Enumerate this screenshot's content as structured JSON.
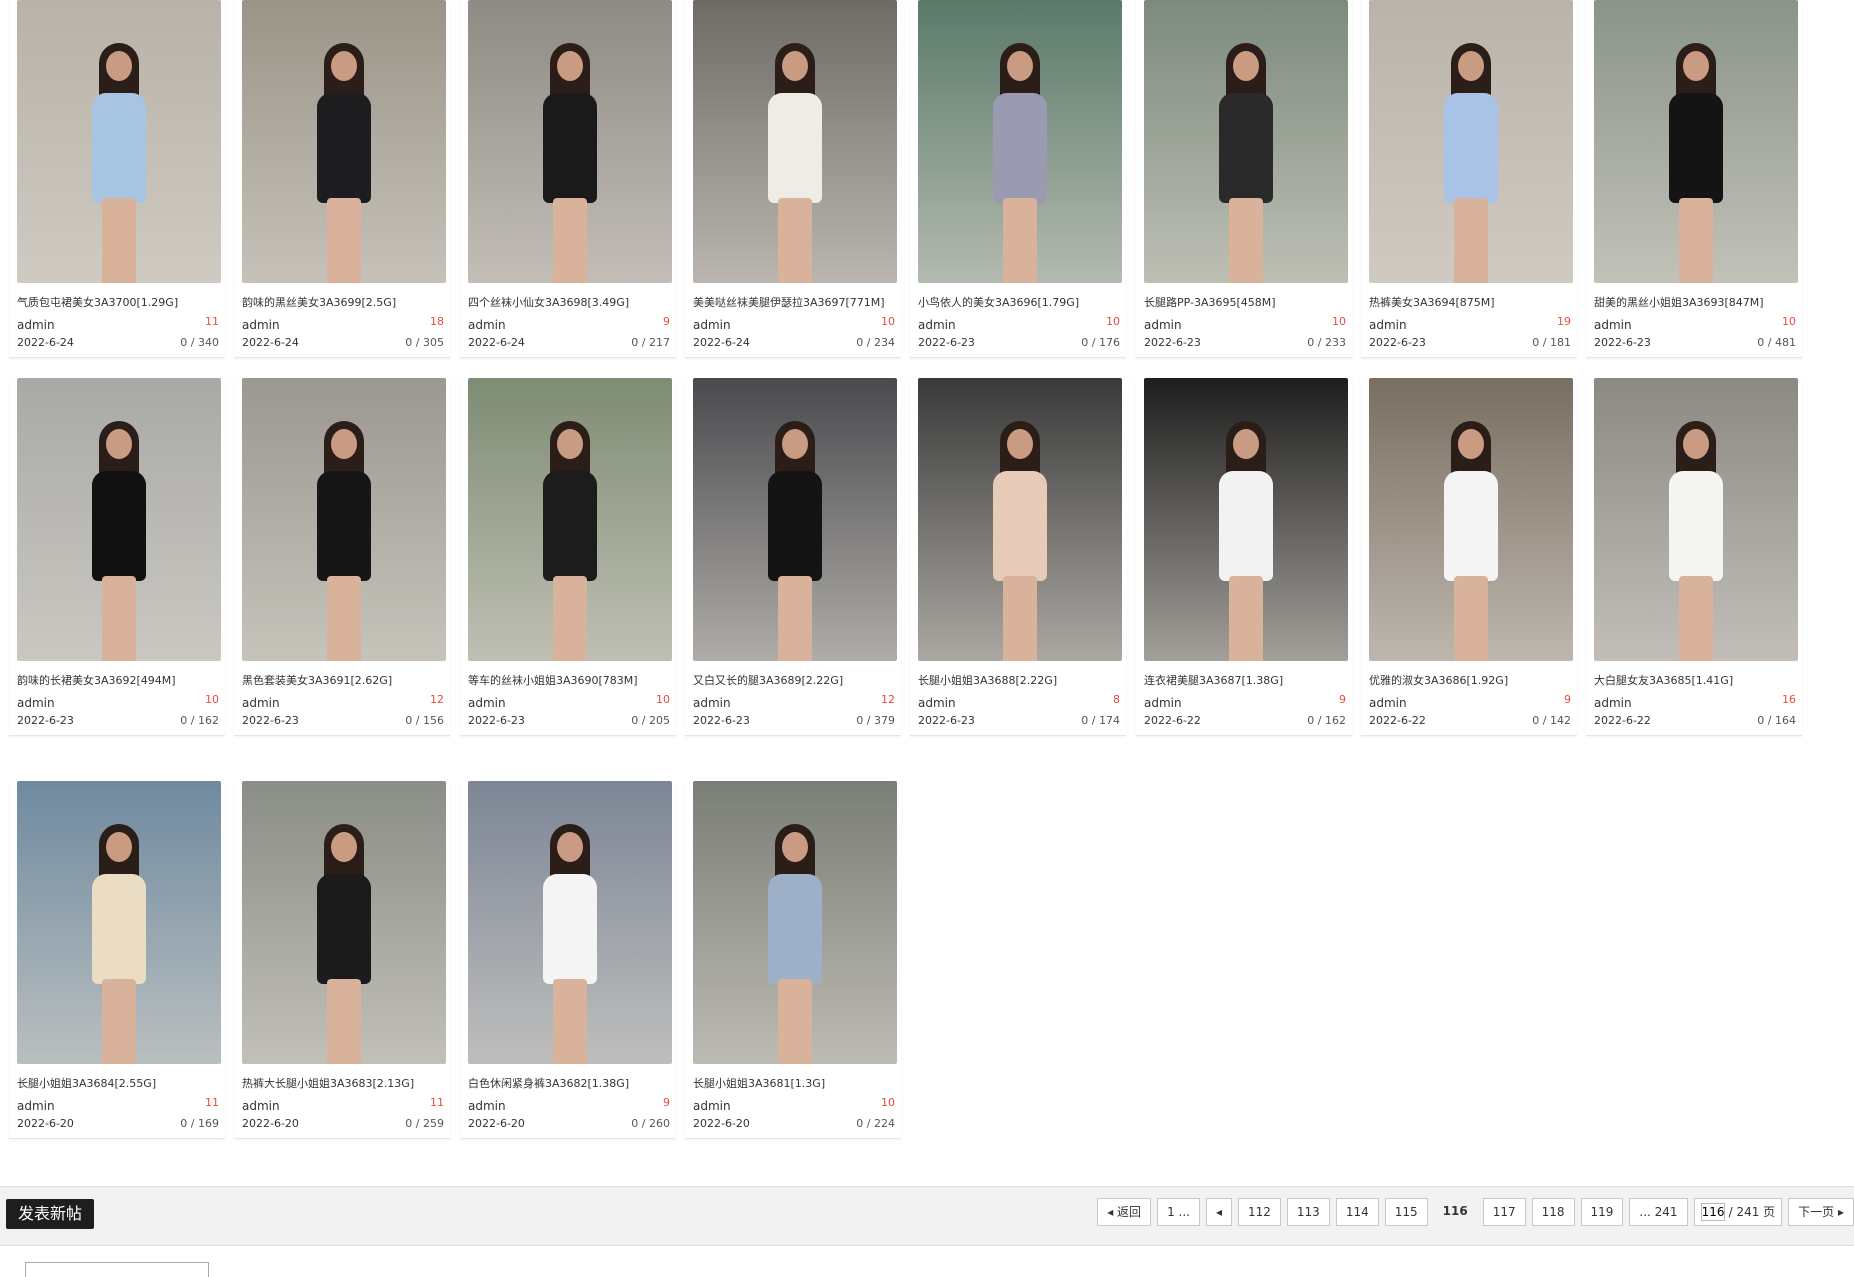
{
  "cards": [
    {
      "title": "气质包屯裙美女3A3700[1.29G]",
      "author": "admin",
      "count": "11",
      "date": "2022-6-24",
      "stats": "0 / 340",
      "colors": {
        "bg": "#b8b2a8",
        "outfit": "#a7c4e2"
      }
    },
    {
      "title": "韵味的黑丝美女3A3699[2.5G]",
      "author": "admin",
      "count": "18",
      "date": "2022-6-24",
      "stats": "0 / 305",
      "colors": {
        "bg": "#9a9488",
        "outfit": "#1d1d1f"
      }
    },
    {
      "title": "四个丝袜小仙女3A3698[3.49G]",
      "author": "admin",
      "count": "9",
      "date": "2022-6-24",
      "stats": "0 / 217",
      "colors": {
        "bg": "#8e8a84",
        "outfit": "#1a1a1a"
      }
    },
    {
      "title": "美美哒丝袜美腿伊瑟拉3A3697[771M]",
      "author": "admin",
      "count": "10",
      "date": "2022-6-24",
      "stats": "0 / 234",
      "colors": {
        "bg": "#6e6a66",
        "outfit": "#efece6"
      }
    },
    {
      "title": "小鸟依人的美女3A3696[1.79G]",
      "author": "admin",
      "count": "10",
      "date": "2022-6-23",
      "stats": "0 / 176",
      "colors": {
        "bg": "#5a7a6a",
        "outfit": "#9a9ab0"
      }
    },
    {
      "title": "长腿路PP-3A3695[458M]",
      "author": "admin",
      "count": "10",
      "date": "2022-6-23",
      "stats": "0 / 233",
      "colors": {
        "bg": "#7c8a7c",
        "outfit": "#2a2a2a"
      }
    },
    {
      "title": "热裤美女3A3694[875M]",
      "author": "admin",
      "count": "19",
      "date": "2022-6-23",
      "stats": "0 / 181",
      "colors": {
        "bg": "#b8b4ac",
        "outfit": "#a9c3e6"
      }
    },
    {
      "title": "甜美的黑丝小姐姐3A3693[847M]",
      "author": "admin",
      "count": "10",
      "date": "2022-6-23",
      "stats": "0 / 481",
      "colors": {
        "bg": "#8b9488",
        "outfit": "#141414"
      }
    },
    {
      "title": "韵味的长裙美女3A3692[494M]",
      "author": "admin",
      "count": "10",
      "date": "2022-6-23",
      "stats": "0 / 162",
      "colors": {
        "bg": "#a9a9a6",
        "outfit": "#111111"
      }
    },
    {
      "title": "黑色套装美女3A3691[2.62G]",
      "author": "admin",
      "count": "12",
      "date": "2022-6-23",
      "stats": "0 / 156",
      "colors": {
        "bg": "#9a9890",
        "outfit": "#161616"
      }
    },
    {
      "title": "等车的丝袜小姐姐3A3690[783M]",
      "author": "admin",
      "count": "10",
      "date": "2022-6-23",
      "stats": "0 / 205",
      "colors": {
        "bg": "#7e8c74",
        "outfit": "#1c1c1c"
      }
    },
    {
      "title": "又白又长的腿3A3689[2.22G]",
      "author": "admin",
      "count": "12",
      "date": "2022-6-23",
      "stats": "0 / 379",
      "colors": {
        "bg": "#4a4a4e",
        "outfit": "#141414"
      }
    },
    {
      "title": "长腿小姐姐3A3688[2.22G]",
      "author": "admin",
      "count": "8",
      "date": "2022-6-23",
      "stats": "0 / 174",
      "colors": {
        "bg": "#3a3a3a",
        "outfit": "#e6cbb8"
      }
    },
    {
      "title": "连衣裙美腿3A3687[1.38G]",
      "author": "admin",
      "count": "9",
      "date": "2022-6-22",
      "stats": "0 / 162",
      "colors": {
        "bg": "#1e1e1e",
        "outfit": "#f2f2f2"
      }
    },
    {
      "title": "优雅的淑女3A3686[1.92G]",
      "author": "admin",
      "count": "9",
      "date": "2022-6-22",
      "stats": "0 / 142",
      "colors": {
        "bg": "#7a6e62",
        "outfit": "#f4f4f4"
      }
    },
    {
      "title": "大白腿女友3A3685[1.41G]",
      "author": "admin",
      "count": "16",
      "date": "2022-6-22",
      "stats": "0 / 164",
      "colors": {
        "bg": "#8c8884",
        "outfit": "#f4f4f0"
      }
    },
    {
      "title": "长腿小姐姐3A3684[2.55G]",
      "author": "admin",
      "count": "11",
      "date": "2022-6-20",
      "stats": "0 / 169",
      "colors": {
        "bg": "#6f8aa0",
        "outfit": "#ebdcc4"
      }
    },
    {
      "title": "热裤大长腿小姐姐3A3683[2.13G]",
      "author": "admin",
      "count": "11",
      "date": "2022-6-20",
      "stats": "0 / 259",
      "colors": {
        "bg": "#8a8e86",
        "outfit": "#1b1b1b"
      }
    },
    {
      "title": "白色休闲紧身裤3A3682[1.38G]",
      "author": "admin",
      "count": "9",
      "date": "2022-6-20",
      "stats": "0 / 260",
      "colors": {
        "bg": "#7d8696",
        "outfit": "#f4f4f4"
      }
    },
    {
      "title": "长腿小姐姐3A3681[1.3G]",
      "author": "admin",
      "count": "10",
      "date": "2022-6-20",
      "stats": "0 / 224",
      "colors": {
        "bg": "#7a7e76",
        "outfit": "#9eb0c8"
      }
    }
  ],
  "bottom": {
    "new_post": "发表新帖"
  },
  "pager": {
    "back": "◂ 返回",
    "first": "1 ...",
    "prev_icon": "◂",
    "pages": [
      "112",
      "113",
      "114",
      "115"
    ],
    "current": "116",
    "next_pages": [
      "117",
      "118",
      "119"
    ],
    "last": "... 241",
    "page_input": "116",
    "total": "/ 241 页",
    "next": "下一页 ▸"
  }
}
